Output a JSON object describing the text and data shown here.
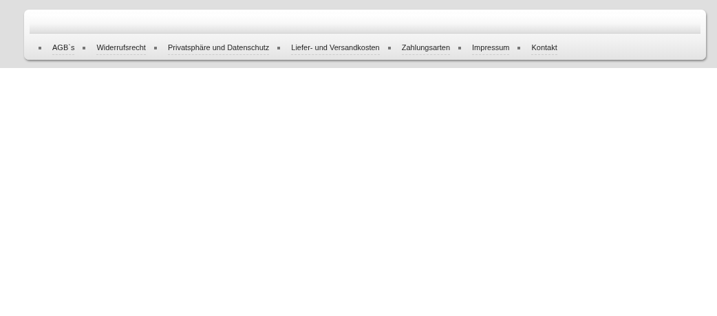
{
  "footer_nav": [
    {
      "label": "AGB`s"
    },
    {
      "label": "Widerrufsrecht"
    },
    {
      "label": "Privatsphäre und Datenschutz"
    },
    {
      "label": "Liefer- und Versandkosten"
    },
    {
      "label": "Zahlungsarten"
    },
    {
      "label": "Impressum"
    },
    {
      "label": "Kontakt"
    }
  ]
}
